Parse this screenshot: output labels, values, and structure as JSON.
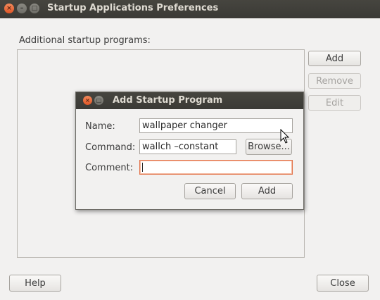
{
  "window": {
    "title": "Startup Applications Preferences",
    "controls": {
      "close": "×",
      "minimize": "–",
      "maximize": "□"
    }
  },
  "main": {
    "section_label": "Additional startup programs:",
    "buttons": {
      "add": "Add",
      "remove": "Remove",
      "edit": "Edit"
    }
  },
  "footer": {
    "help": "Help",
    "close": "Close"
  },
  "dialog": {
    "title": "Add Startup Program",
    "controls": {
      "close": "×",
      "other": "□"
    },
    "fields": {
      "name_label": "Name:",
      "name_value": "wallpaper changer",
      "command_label": "Command:",
      "command_value": "wallch –constant",
      "comment_label": "Comment:",
      "comment_value": ""
    },
    "browse": "Browse...",
    "cancel": "Cancel",
    "add": "Add"
  },
  "colors": {
    "accent": "#e05627",
    "titlebar": "#3b3a36"
  }
}
